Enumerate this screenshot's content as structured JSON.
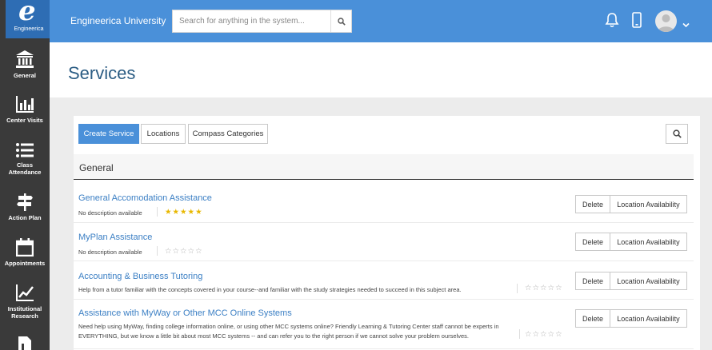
{
  "sidebar": {
    "logo_text": "Engineerica",
    "items": [
      {
        "label": "General",
        "icon": "institution-icon"
      },
      {
        "label": "Center Visits",
        "icon": "bar-chart-icon"
      },
      {
        "label": "Class Attendance",
        "icon": "list-icon"
      },
      {
        "label": "Action Plan",
        "icon": "signpost-icon"
      },
      {
        "label": "Appointments",
        "icon": "calendar-icon"
      },
      {
        "label": "Institutional Research",
        "icon": "line-chart-icon"
      }
    ]
  },
  "topbar": {
    "brand": "Engineerica University",
    "search_placeholder": "Search for anything in the system...",
    "accent": "#4a90d9"
  },
  "page": {
    "title": "Services"
  },
  "toolbar": {
    "create_label": "Create Service",
    "locations_label": "Locations",
    "categories_label": "Compass Categories"
  },
  "section": {
    "title": "General"
  },
  "services": [
    {
      "name": "General Accomodation Assistance",
      "description": "No description available",
      "rating_filled": 5,
      "delete_label": "Delete",
      "availability_label": "Location Availability"
    },
    {
      "name": "MyPlan Assistance",
      "description": "No description available",
      "rating_filled": 0,
      "delete_label": "Delete",
      "availability_label": "Location Availability"
    },
    {
      "name": "Accounting & Business Tutoring",
      "description": "Help from a tutor familiar with the concepts covered in your course--and familiar with the study strategies needed to succeed in this subject area.",
      "rating_filled": 0,
      "delete_label": "Delete",
      "availability_label": "Location Availability"
    },
    {
      "name": "Assistance with MyWay or Other MCC Online Systems",
      "description": "Need help using MyWay, finding college information online, or using other MCC systems online? Friendly Learning & Tutoring Center staff cannot be experts in EVERYTHING, but we know a little bit about most MCC systems -- and can refer you to the right person if we cannot solve your problem ourselves.",
      "rating_filled": 0,
      "delete_label": "Delete",
      "availability_label": "Location Availability"
    }
  ]
}
